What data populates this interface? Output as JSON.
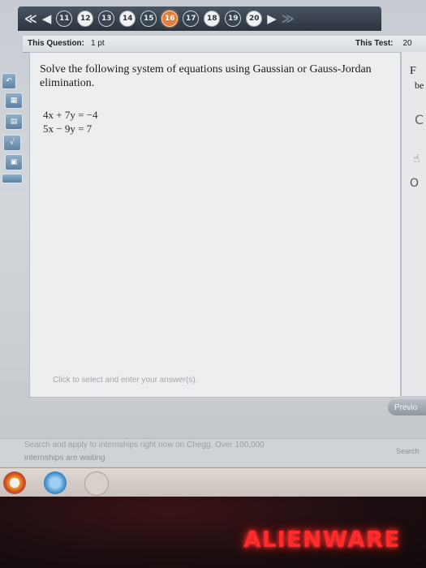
{
  "nav": {
    "back_all": "≪",
    "back": "◀",
    "numbers": [
      "11",
      "12",
      "13",
      "14",
      "15",
      "16",
      "17",
      "18",
      "19",
      "20"
    ],
    "current": "16",
    "forward": "▶",
    "forward_all": "≫"
  },
  "status": {
    "question_label": "This Question:",
    "question_value": "1 pt",
    "test_label": "This Test:",
    "test_value": "20"
  },
  "question": {
    "prompt": "Solve the following system of equations using Gaussian or Gauss-Jordan elimination.",
    "equations": [
      "4x + 7y = −4",
      "5x − 9y = 7"
    ],
    "answer_hint": "Click to select and enter your answer(s)."
  },
  "side_panel": {
    "letter": "F",
    "text": "be",
    "radio_c": "C",
    "radio_o": "O"
  },
  "buttons": {
    "previous": "Previo"
  },
  "browser_ad": {
    "line1": "Search and apply to internships right now on Chegg. Over 100,000",
    "line2": "internships are waiting",
    "search_label": "Search"
  },
  "bezel": {
    "brand": "ALIENWARE"
  },
  "colors": {
    "current_question": "#e87a3a",
    "brand": "#ff2a2a",
    "navbar": "#2b333d"
  }
}
